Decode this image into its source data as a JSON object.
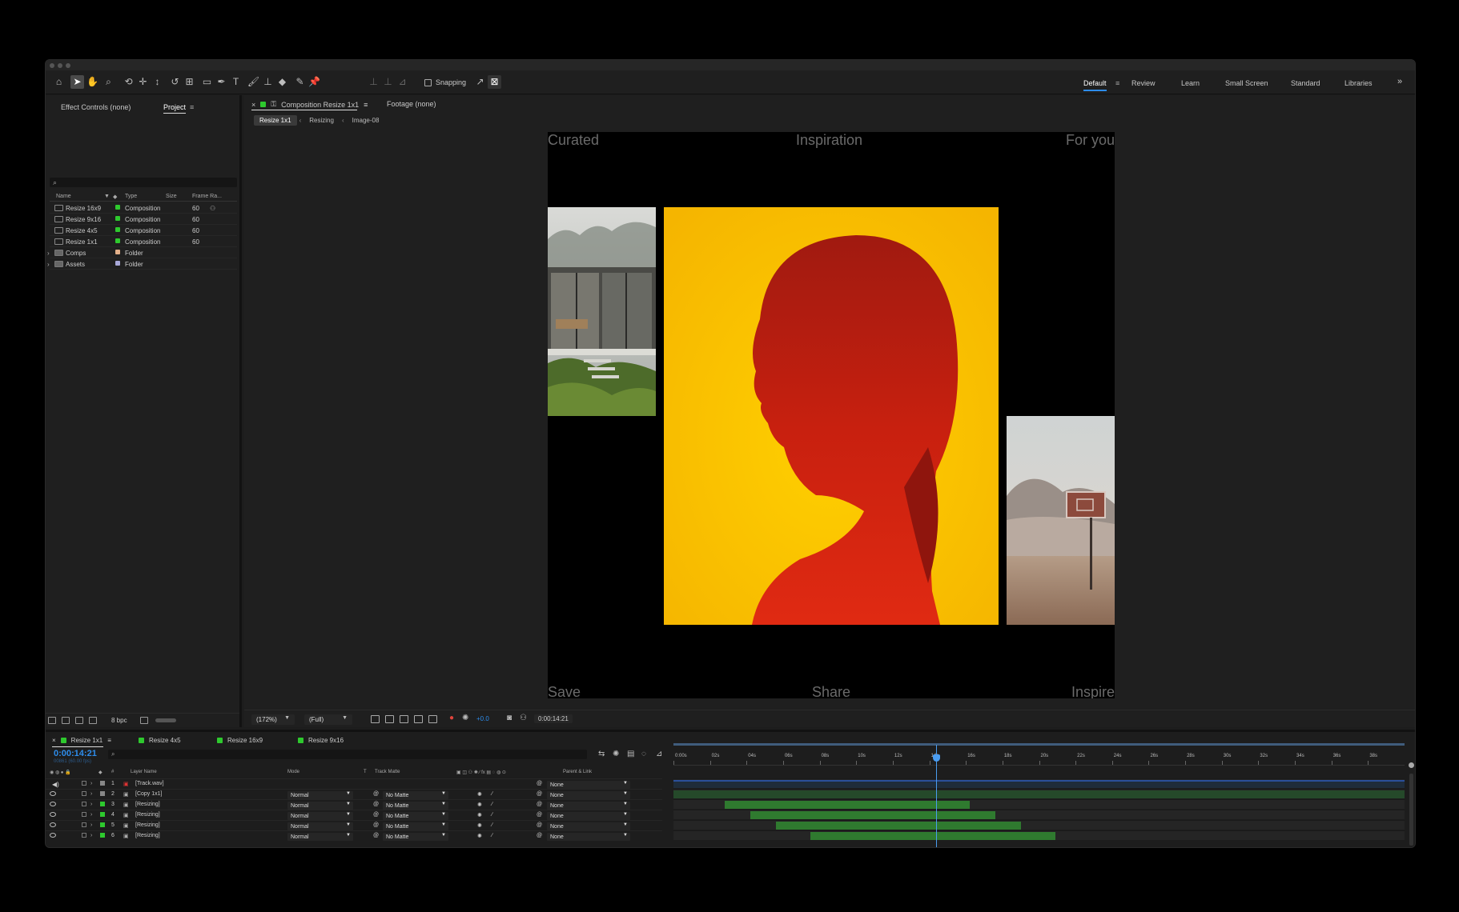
{
  "toolbar": {
    "snapping_label": "Snapping",
    "workspaces": [
      "Default",
      "Review",
      "Learn",
      "Small Screen",
      "Standard",
      "Libraries"
    ]
  },
  "project_panel": {
    "tabs": [
      "Effect Controls (none)",
      "Project"
    ],
    "search_placeholder": "",
    "columns": [
      "Name",
      "Type",
      "Size",
      "Frame Ra..."
    ],
    "items": [
      {
        "name": "Resize 16x9",
        "type": "Composition",
        "size": "",
        "frame_rate": "60",
        "swatch": "#2ec92e"
      },
      {
        "name": "Resize 9x16",
        "type": "Composition",
        "size": "",
        "frame_rate": "60",
        "swatch": "#2ec92e"
      },
      {
        "name": "Resize 4x5",
        "type": "Composition",
        "size": "",
        "frame_rate": "60",
        "swatch": "#2ec92e"
      },
      {
        "name": "Resize 1x1",
        "type": "Composition",
        "size": "",
        "frame_rate": "60",
        "swatch": "#2ec92e"
      },
      {
        "name": "Comps",
        "type": "Folder",
        "size": "",
        "frame_rate": "",
        "swatch": "#e3b08a"
      },
      {
        "name": "Assets",
        "type": "Folder",
        "size": "",
        "frame_rate": "",
        "swatch": "#a8a8d8"
      }
    ],
    "bpc_label": "8 bpc"
  },
  "comp_panel": {
    "tabs": [
      "Composition Resize 1x1",
      "Footage (none)"
    ],
    "breadcrumbs": [
      "Resize 1x1",
      "Resizing",
      "Image-08"
    ],
    "canvas_texts": {
      "top_left": "Curated",
      "top_center": "Inspiration",
      "top_right": "For you",
      "bottom_left": "Save",
      "bottom_center": "Share",
      "bottom_right": "Inspire"
    },
    "zoom": "(172%)",
    "resolution": "(Full)",
    "exposure": "+0.0",
    "timecode": "0:00:14:21"
  },
  "timeline": {
    "tabs": [
      "Resize 1x1",
      "Resize 4x5",
      "Resize 16x9",
      "Resize 9x16"
    ],
    "timecode": "0:00:14:21",
    "timecode_sub": "00861 (60.00 fps)",
    "columns": [
      "Layer Name",
      "Mode",
      "T",
      "Track Matte",
      "Parent & Link"
    ],
    "layers": [
      {
        "num": "1",
        "name": "[Track.wav]",
        "mode": "",
        "matte": "",
        "parent": "None"
      },
      {
        "num": "2",
        "name": "[Copy 1x1]",
        "mode": "Normal",
        "matte": "No Matte",
        "parent": "None"
      },
      {
        "num": "3",
        "name": "[Resizing]",
        "mode": "Normal",
        "matte": "No Matte",
        "parent": "None"
      },
      {
        "num": "4",
        "name": "[Resizing]",
        "mode": "Normal",
        "matte": "No Matte",
        "parent": "None"
      },
      {
        "num": "5",
        "name": "[Resizing]",
        "mode": "Normal",
        "matte": "No Matte",
        "parent": "None"
      },
      {
        "num": "6",
        "name": "[Resizing]",
        "mode": "Normal",
        "matte": "No Matte",
        "parent": "None"
      }
    ],
    "ruler_ticks": [
      "0:00s",
      "02s",
      "04s",
      "06s",
      "08s",
      "10s",
      "12s",
      "14s",
      "16s",
      "18s",
      "20s",
      "22s",
      "24s",
      "26s",
      "28s",
      "30s",
      "32s",
      "34s",
      "36s",
      "38s"
    ],
    "playhead_seconds": 14.35,
    "duration_seconds": 40,
    "layer_bars": [
      {
        "start": 0,
        "end": 40,
        "dark": true
      },
      {
        "start": 0,
        "end": 40,
        "dark": true
      },
      {
        "start": 2.8,
        "end": 16.2,
        "dark": false
      },
      {
        "start": 4.2,
        "end": 17.6,
        "dark": false
      },
      {
        "start": 5.6,
        "end": 19.0,
        "dark": false
      },
      {
        "start": 7.5,
        "end": 20.9,
        "dark": false
      }
    ]
  }
}
